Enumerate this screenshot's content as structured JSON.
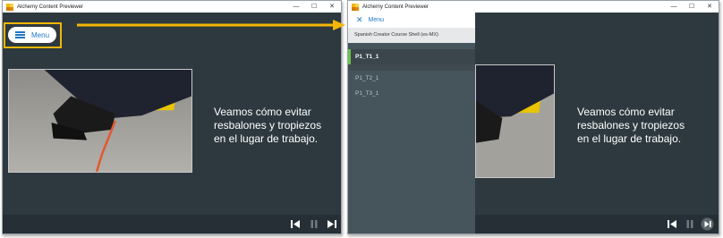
{
  "app": {
    "title": "Alchemy Content Previewer"
  },
  "window_controls": {
    "minimize": "—",
    "maximize": "☐",
    "close": "✕"
  },
  "left_view": {
    "menu_label": "Menu",
    "caption_lines": [
      "Veamos cómo evitar",
      "resbalones y tropiezos",
      "en el lugar de trabajo."
    ]
  },
  "right_view": {
    "drawer": {
      "close_label": "Menu",
      "course_title": "Spanish Creator Course Shell (es-MX)",
      "items": [
        {
          "label": "P1_T1_1",
          "active": true
        },
        {
          "label": "P1_T2_1",
          "active": false
        },
        {
          "label": "P1_T3_1",
          "active": false
        }
      ]
    },
    "caption_lines": [
      "Veamos cómo evitar",
      "resbalones y tropiezos",
      "en el lugar de trabajo."
    ]
  },
  "player_controls": [
    "previous",
    "pause",
    "next"
  ],
  "colors": {
    "accent": "#1f78c8",
    "highlight": "#f2b705",
    "active_marker": "#6cc24a",
    "background": "#2e393f"
  }
}
